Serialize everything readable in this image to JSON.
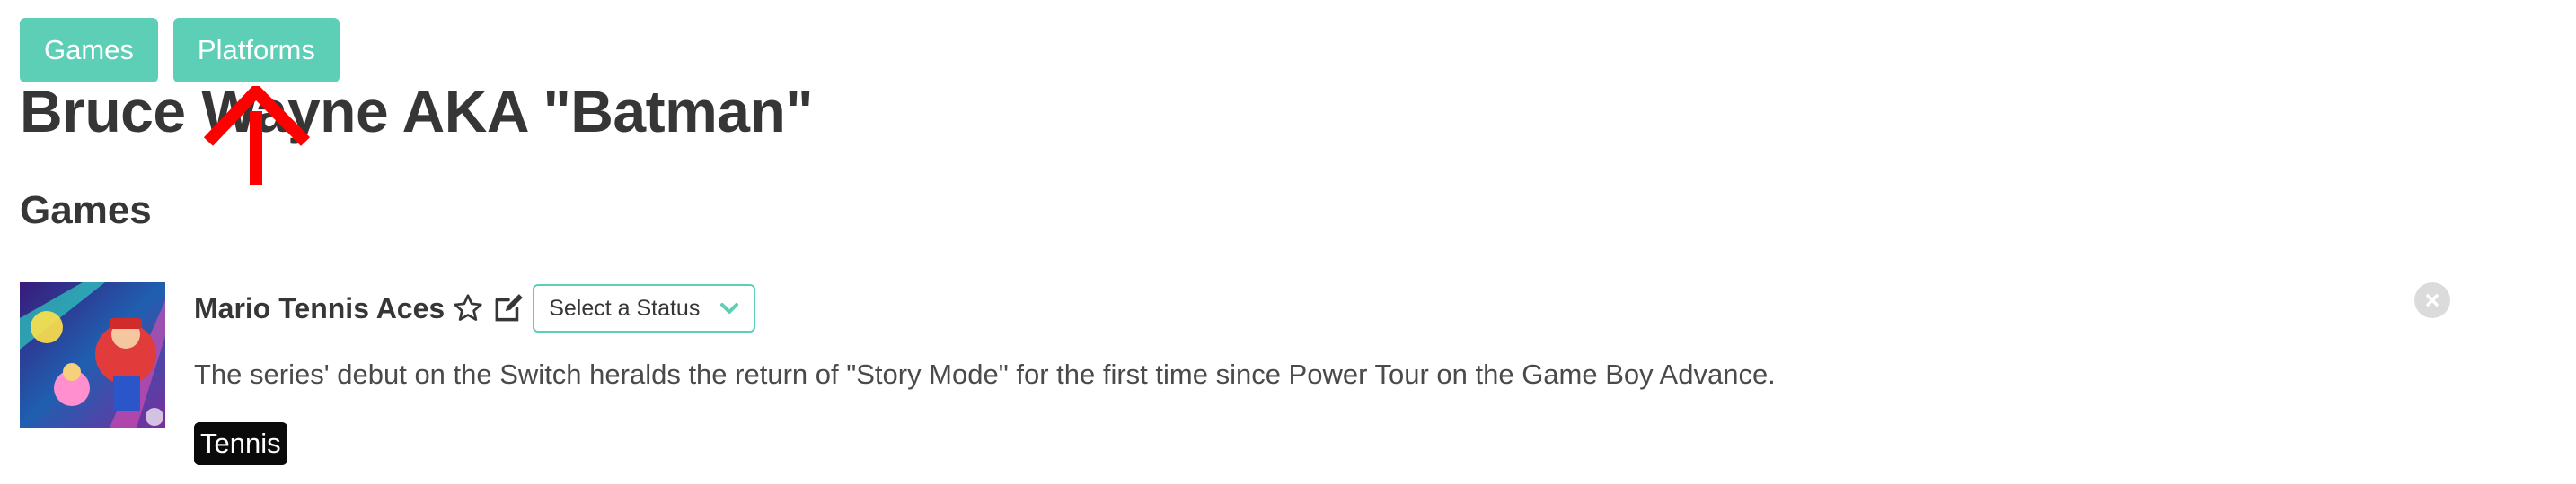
{
  "nav": {
    "games_label": "Games",
    "platforms_label": "Platforms"
  },
  "page": {
    "title": "Bruce Wayne AKA \"Batman\""
  },
  "games_section": {
    "title": "Games",
    "items": [
      {
        "title": "Mario Tennis Aces",
        "favorite_icon": "star-outline-icon",
        "edit_icon": "edit-icon",
        "status_select": {
          "selected": "Select a Status"
        },
        "description": "The series' debut on the Switch heralds the return of \"Story Mode\" for the first time since Power Tour on the Game Boy Advance.",
        "tags": [
          "Tennis"
        ],
        "remove_icon": "close-circle-icon"
      }
    ]
  },
  "colors": {
    "accent": "#5ccfb6",
    "text": "#363636",
    "tag_bg": "#0a0a0a",
    "annotation": "#ff0000"
  }
}
